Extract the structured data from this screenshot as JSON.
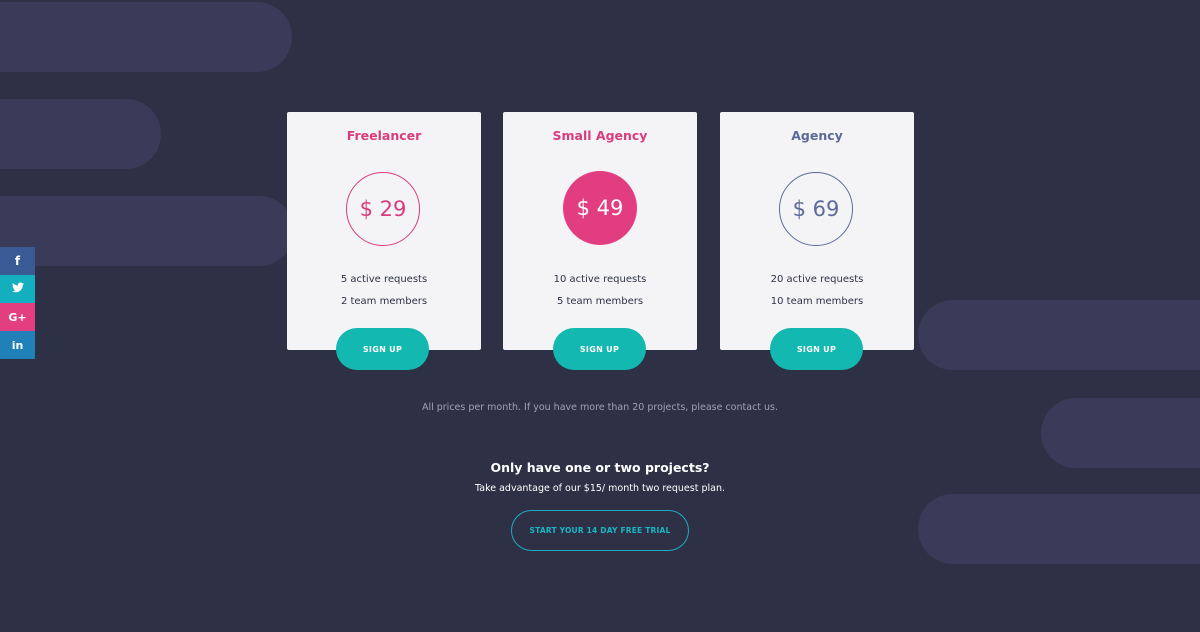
{
  "social": {
    "items": [
      {
        "icon": "facebook-icon",
        "glyph": "f"
      },
      {
        "icon": "twitter-icon",
        "glyph": "🐦"
      },
      {
        "icon": "google-plus-icon",
        "glyph": "G+"
      },
      {
        "icon": "linkedin-icon",
        "glyph": "in"
      }
    ]
  },
  "plans": [
    {
      "name": "Freelancer",
      "price": "$ 29",
      "features": [
        "5 active requests",
        "2 team members"
      ],
      "button": "SIGN UP",
      "accent": "#d93c7d",
      "highlighted": false
    },
    {
      "name": "Small Agency",
      "price": "$ 49",
      "features": [
        "10 active requests",
        "5 team members"
      ],
      "button": "SIGN UP",
      "accent": "#e23d80",
      "highlighted": true
    },
    {
      "name": "Agency",
      "price": "$ 69",
      "features": [
        "20 active requests",
        "10 team members"
      ],
      "button": "SIGN UP",
      "accent": "#5b6a9a",
      "highlighted": false
    }
  ],
  "note": "All prices per month. If you have more than 20 projects, please contact us.",
  "promo": {
    "heading": "Only have one or two projects?",
    "subtext": "Take advantage of our $15/ month two request plan.",
    "cta": "START YOUR 14 DAY FREE TRIAL"
  },
  "colors": {
    "background": "#2e3146",
    "pill": "#3a3b58",
    "card": "#f4f4f6",
    "teal": "#13b8b0",
    "pink": "#e23d80"
  }
}
